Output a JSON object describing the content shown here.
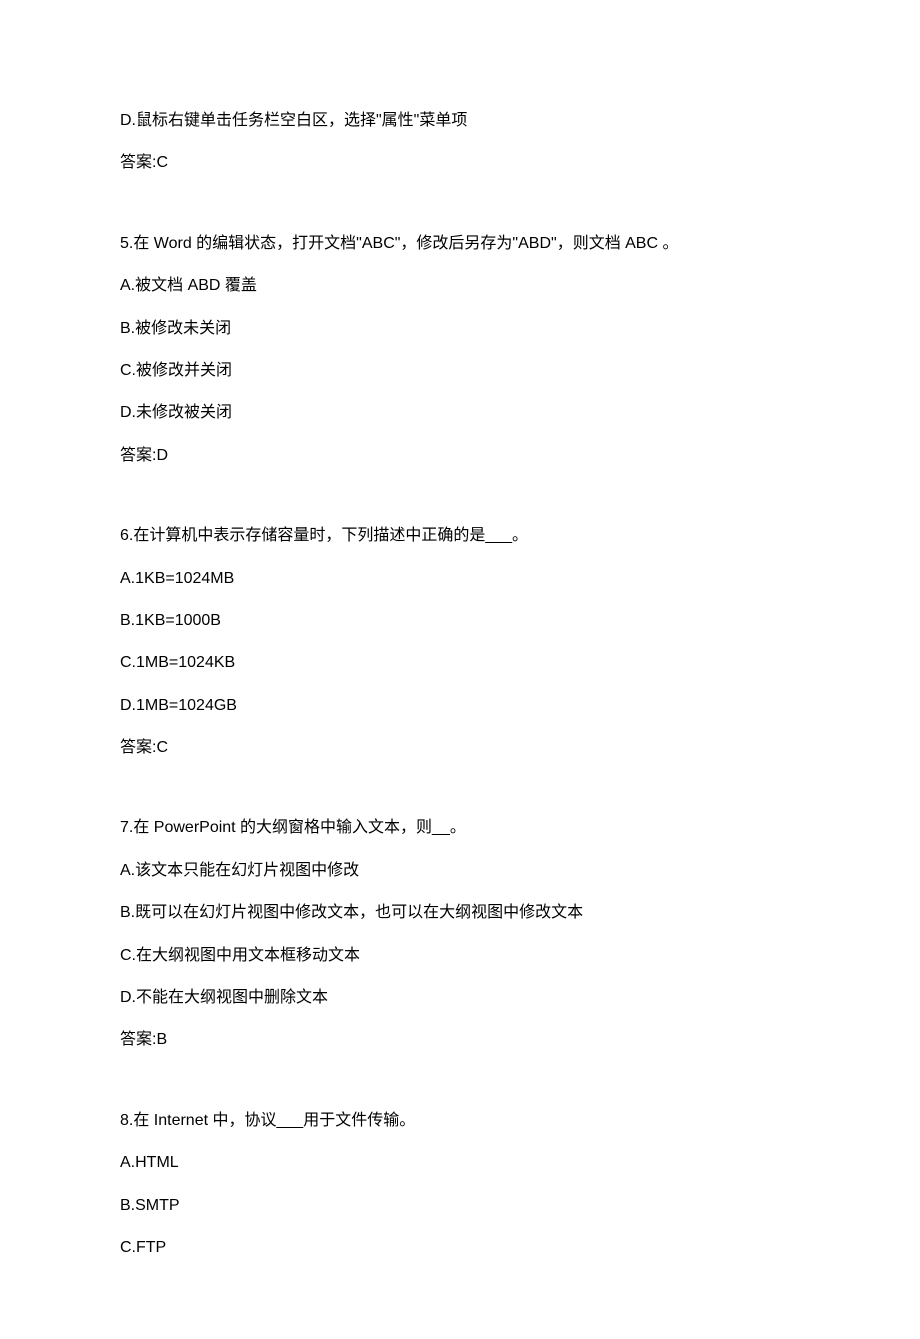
{
  "lines": [
    {
      "kind": "text",
      "content": "D.鼠标右键单击任务栏空白区，选择\"属性\"菜单项"
    },
    {
      "kind": "text",
      "content": "答案:C"
    },
    {
      "kind": "gap"
    },
    {
      "kind": "text",
      "content": "5.在 Word 的编辑状态，打开文档\"ABC\"，修改后另存为\"ABD\"，则文档 ABC  。"
    },
    {
      "kind": "text",
      "content": "A.被文档 ABD 覆盖"
    },
    {
      "kind": "text",
      "content": "B.被修改未关闭"
    },
    {
      "kind": "text",
      "content": "C.被修改并关闭"
    },
    {
      "kind": "text",
      "content": "D.未修改被关闭"
    },
    {
      "kind": "text",
      "content": "答案:D"
    },
    {
      "kind": "gap"
    },
    {
      "kind": "text",
      "content": "6.在计算机中表示存储容量时，下列描述中正确的是___。"
    },
    {
      "kind": "text",
      "content": "A.1KB=1024MB"
    },
    {
      "kind": "text",
      "content": "B.1KB=1000B"
    },
    {
      "kind": "text",
      "content": "C.1MB=1024KB"
    },
    {
      "kind": "text",
      "content": "D.1MB=1024GB"
    },
    {
      "kind": "text",
      "content": "答案:C"
    },
    {
      "kind": "gap"
    },
    {
      "kind": "text",
      "content": "7.在 PowerPoint 的大纲窗格中输入文本，则__。"
    },
    {
      "kind": "text",
      "content": "A.该文本只能在幻灯片视图中修改"
    },
    {
      "kind": "text",
      "content": "B.既可以在幻灯片视图中修改文本，也可以在大纲视图中修改文本"
    },
    {
      "kind": "text",
      "content": "C.在大纲视图中用文本框移动文本"
    },
    {
      "kind": "text",
      "content": "D.不能在大纲视图中删除文本"
    },
    {
      "kind": "text",
      "content": "答案:B"
    },
    {
      "kind": "gap"
    },
    {
      "kind": "text",
      "content": "8.在 Internet 中，协议___用于文件传输。"
    },
    {
      "kind": "text",
      "content": "A.HTML"
    },
    {
      "kind": "text",
      "content": "B.SMTP"
    },
    {
      "kind": "text",
      "content": "C.FTP"
    }
  ]
}
